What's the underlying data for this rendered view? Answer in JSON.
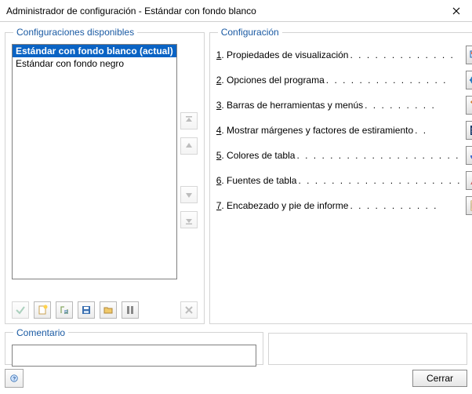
{
  "window": {
    "title": "Administrador de configuración - Estándar con fondo blanco"
  },
  "leftPanel": {
    "legend": "Configuraciones disponibles",
    "items": [
      {
        "label": "Estándar con fondo blanco (actual)",
        "selected": true
      },
      {
        "label": "Estándar con fondo negro",
        "selected": false
      }
    ]
  },
  "rightPanel": {
    "legend": "Configuración",
    "items": [
      {
        "num": "1",
        "label": ". Propiedades de visualización",
        "icon": "display-properties-icon"
      },
      {
        "num": "2",
        "label": ". Opciones del programa",
        "icon": "program-options-icon"
      },
      {
        "num": "3",
        "label": ". Barras de herramientas y menús",
        "icon": "toolbars-menus-icon"
      },
      {
        "num": "4",
        "label": ". Mostrar márgenes y factores de estiramiento",
        "icon": "margins-stretch-icon"
      },
      {
        "num": "5",
        "label": ". Colores de tabla",
        "icon": "table-colors-icon"
      },
      {
        "num": "6",
        "label": ". Fuentes de tabla",
        "icon": "table-fonts-icon"
      },
      {
        "num": "7",
        "label": ". Encabezado y pie de informe",
        "icon": "header-footer-icon"
      }
    ]
  },
  "commentPanel": {
    "legend": "Comentario",
    "value": ""
  },
  "footer": {
    "close": "Cerrar"
  },
  "toolbar": {
    "apply": "apply",
    "new": "new",
    "rename": "rename",
    "save": "save",
    "open": "open",
    "settings": "settings",
    "delete": "delete"
  }
}
